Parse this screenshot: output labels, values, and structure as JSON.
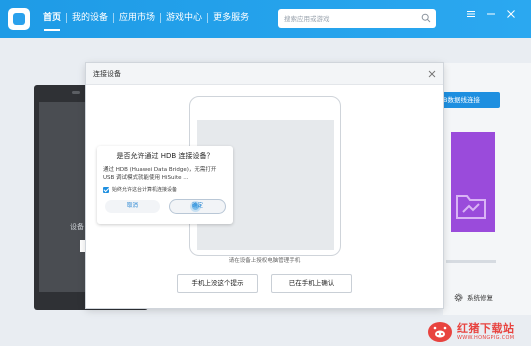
{
  "app": {
    "nav": [
      {
        "label": "首页",
        "active": true
      },
      {
        "label": "我的设备"
      },
      {
        "label": "应用市场"
      },
      {
        "label": "游戏中心"
      },
      {
        "label": "更多服务"
      }
    ],
    "search_placeholder": "搜索应用或游戏",
    "accent_color": "#1e9be6"
  },
  "background": {
    "device_label": "设备",
    "connect_button": "B数据线连接",
    "settings_label": "系统修复"
  },
  "modal": {
    "title": "连接设备",
    "phone_dialog": {
      "title": "是否允许通过 HDB 连接设备？",
      "body": "通过 HDB (Huawei Data Bridge)，无需打开 USB 调试模式就能使用 HiSuite ...",
      "checkbox_label": "始终允许这台计算机连接设备",
      "cancel": "取消",
      "allow": "确定"
    },
    "hint": "请在设备上授权电脑管理手机",
    "button_not_shown": "手机上没这个提示",
    "button_confirmed": "已在手机上确认"
  },
  "watermark": {
    "title": "红猪下载站",
    "url": "WWW.HONGPIG.COM",
    "color": "#e8433f"
  }
}
